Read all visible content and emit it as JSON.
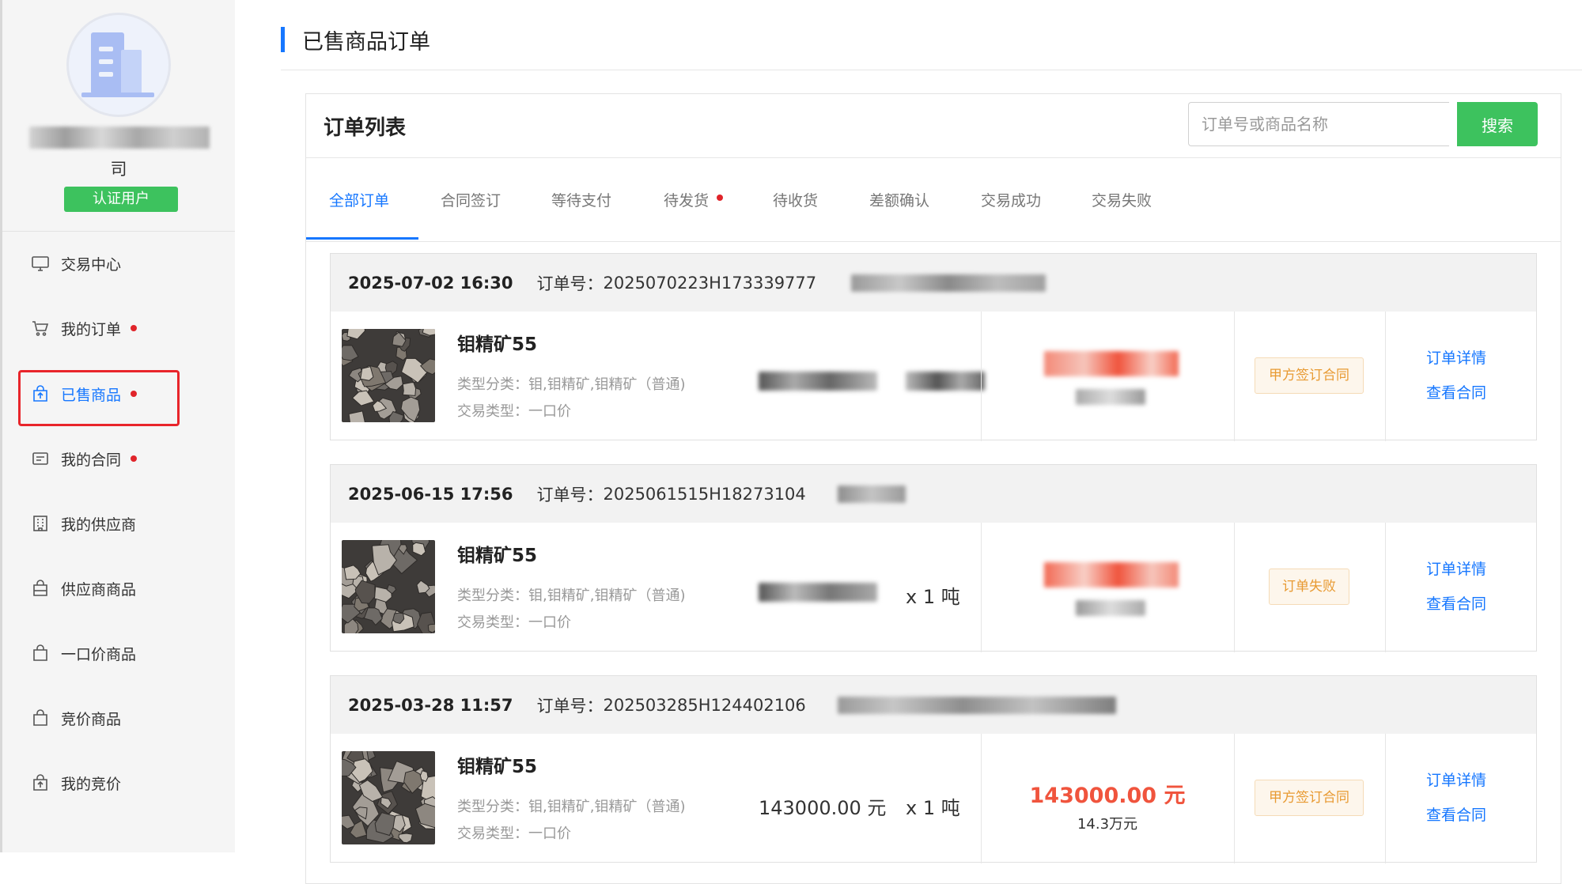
{
  "sidebar": {
    "company_tail": "司",
    "cert_badge": "认证用户",
    "items": [
      {
        "label": "交易中心",
        "icon": "monitor-icon",
        "dot": false,
        "active": false
      },
      {
        "label": "我的订单",
        "icon": "cart-icon",
        "dot": true,
        "active": false
      },
      {
        "label": "已售商品",
        "icon": "sold-bag-icon",
        "dot": true,
        "active": true
      },
      {
        "label": "我的合同",
        "icon": "contract-icon",
        "dot": true,
        "active": false
      },
      {
        "label": "我的供应商",
        "icon": "building-icon",
        "dot": false,
        "active": false
      },
      {
        "label": "供应商商品",
        "icon": "bag-icon",
        "dot": false,
        "active": false
      },
      {
        "label": "一口价商品",
        "icon": "bag-icon",
        "dot": false,
        "active": false
      },
      {
        "label": "竞价商品",
        "icon": "bag-icon",
        "dot": false,
        "active": false
      },
      {
        "label": "我的竞价",
        "icon": "bid-bag-icon",
        "dot": false,
        "active": false
      }
    ]
  },
  "header": {
    "title": "已售商品订单"
  },
  "panel": {
    "title": "订单列表",
    "search_placeholder": "订单号或商品名称",
    "search_button": "搜索",
    "tabs": [
      {
        "label": "全部订单",
        "active": true,
        "dot": false
      },
      {
        "label": "合同签订",
        "active": false,
        "dot": false
      },
      {
        "label": "等待支付",
        "active": false,
        "dot": false
      },
      {
        "label": "待发货",
        "active": false,
        "dot": true
      },
      {
        "label": "待收货",
        "active": false,
        "dot": false
      },
      {
        "label": "差额确认",
        "active": false,
        "dot": false
      },
      {
        "label": "交易成功",
        "active": false,
        "dot": false
      },
      {
        "label": "交易失败",
        "active": false,
        "dot": false
      }
    ]
  },
  "orders": [
    {
      "datetime": "2025-07-02 16:30",
      "order_label": "订单号：",
      "order_no": "2025070223H173339777",
      "product_name": "钼精矿55",
      "category": "类型分类：钼,钼精矿,钼精矿（普通)",
      "trade_type": "交易类型：一口价",
      "unit_price": "",
      "quantity": "",
      "total": "",
      "total_sub": "",
      "status": "甲方签订合同",
      "link_detail": "订单详情",
      "link_contract": "查看合同"
    },
    {
      "datetime": "2025-06-15 17:56",
      "order_label": "订单号：",
      "order_no": "2025061515H18273104",
      "product_name": "钼精矿55",
      "category": "类型分类：钼,钼精矿,钼精矿（普通)",
      "trade_type": "交易类型：一口价",
      "unit_price": "",
      "quantity": "x 1 吨",
      "total": "",
      "total_sub": "",
      "status": "订单失败",
      "link_detail": "订单详情",
      "link_contract": "查看合同"
    },
    {
      "datetime": "2025-03-28 11:57",
      "order_label": "订单号：",
      "order_no": "202503285H124402106",
      "product_name": "钼精矿55",
      "category": "类型分类：钼,钼精矿,钼精矿（普通)",
      "trade_type": "交易类型：一口价",
      "unit_price": "143000.00 元",
      "quantity": "x 1 吨",
      "total": "143000.00 元",
      "total_sub": "14.3万元",
      "status": "甲方签订合同",
      "link_detail": "订单详情",
      "link_contract": "查看合同"
    }
  ]
}
